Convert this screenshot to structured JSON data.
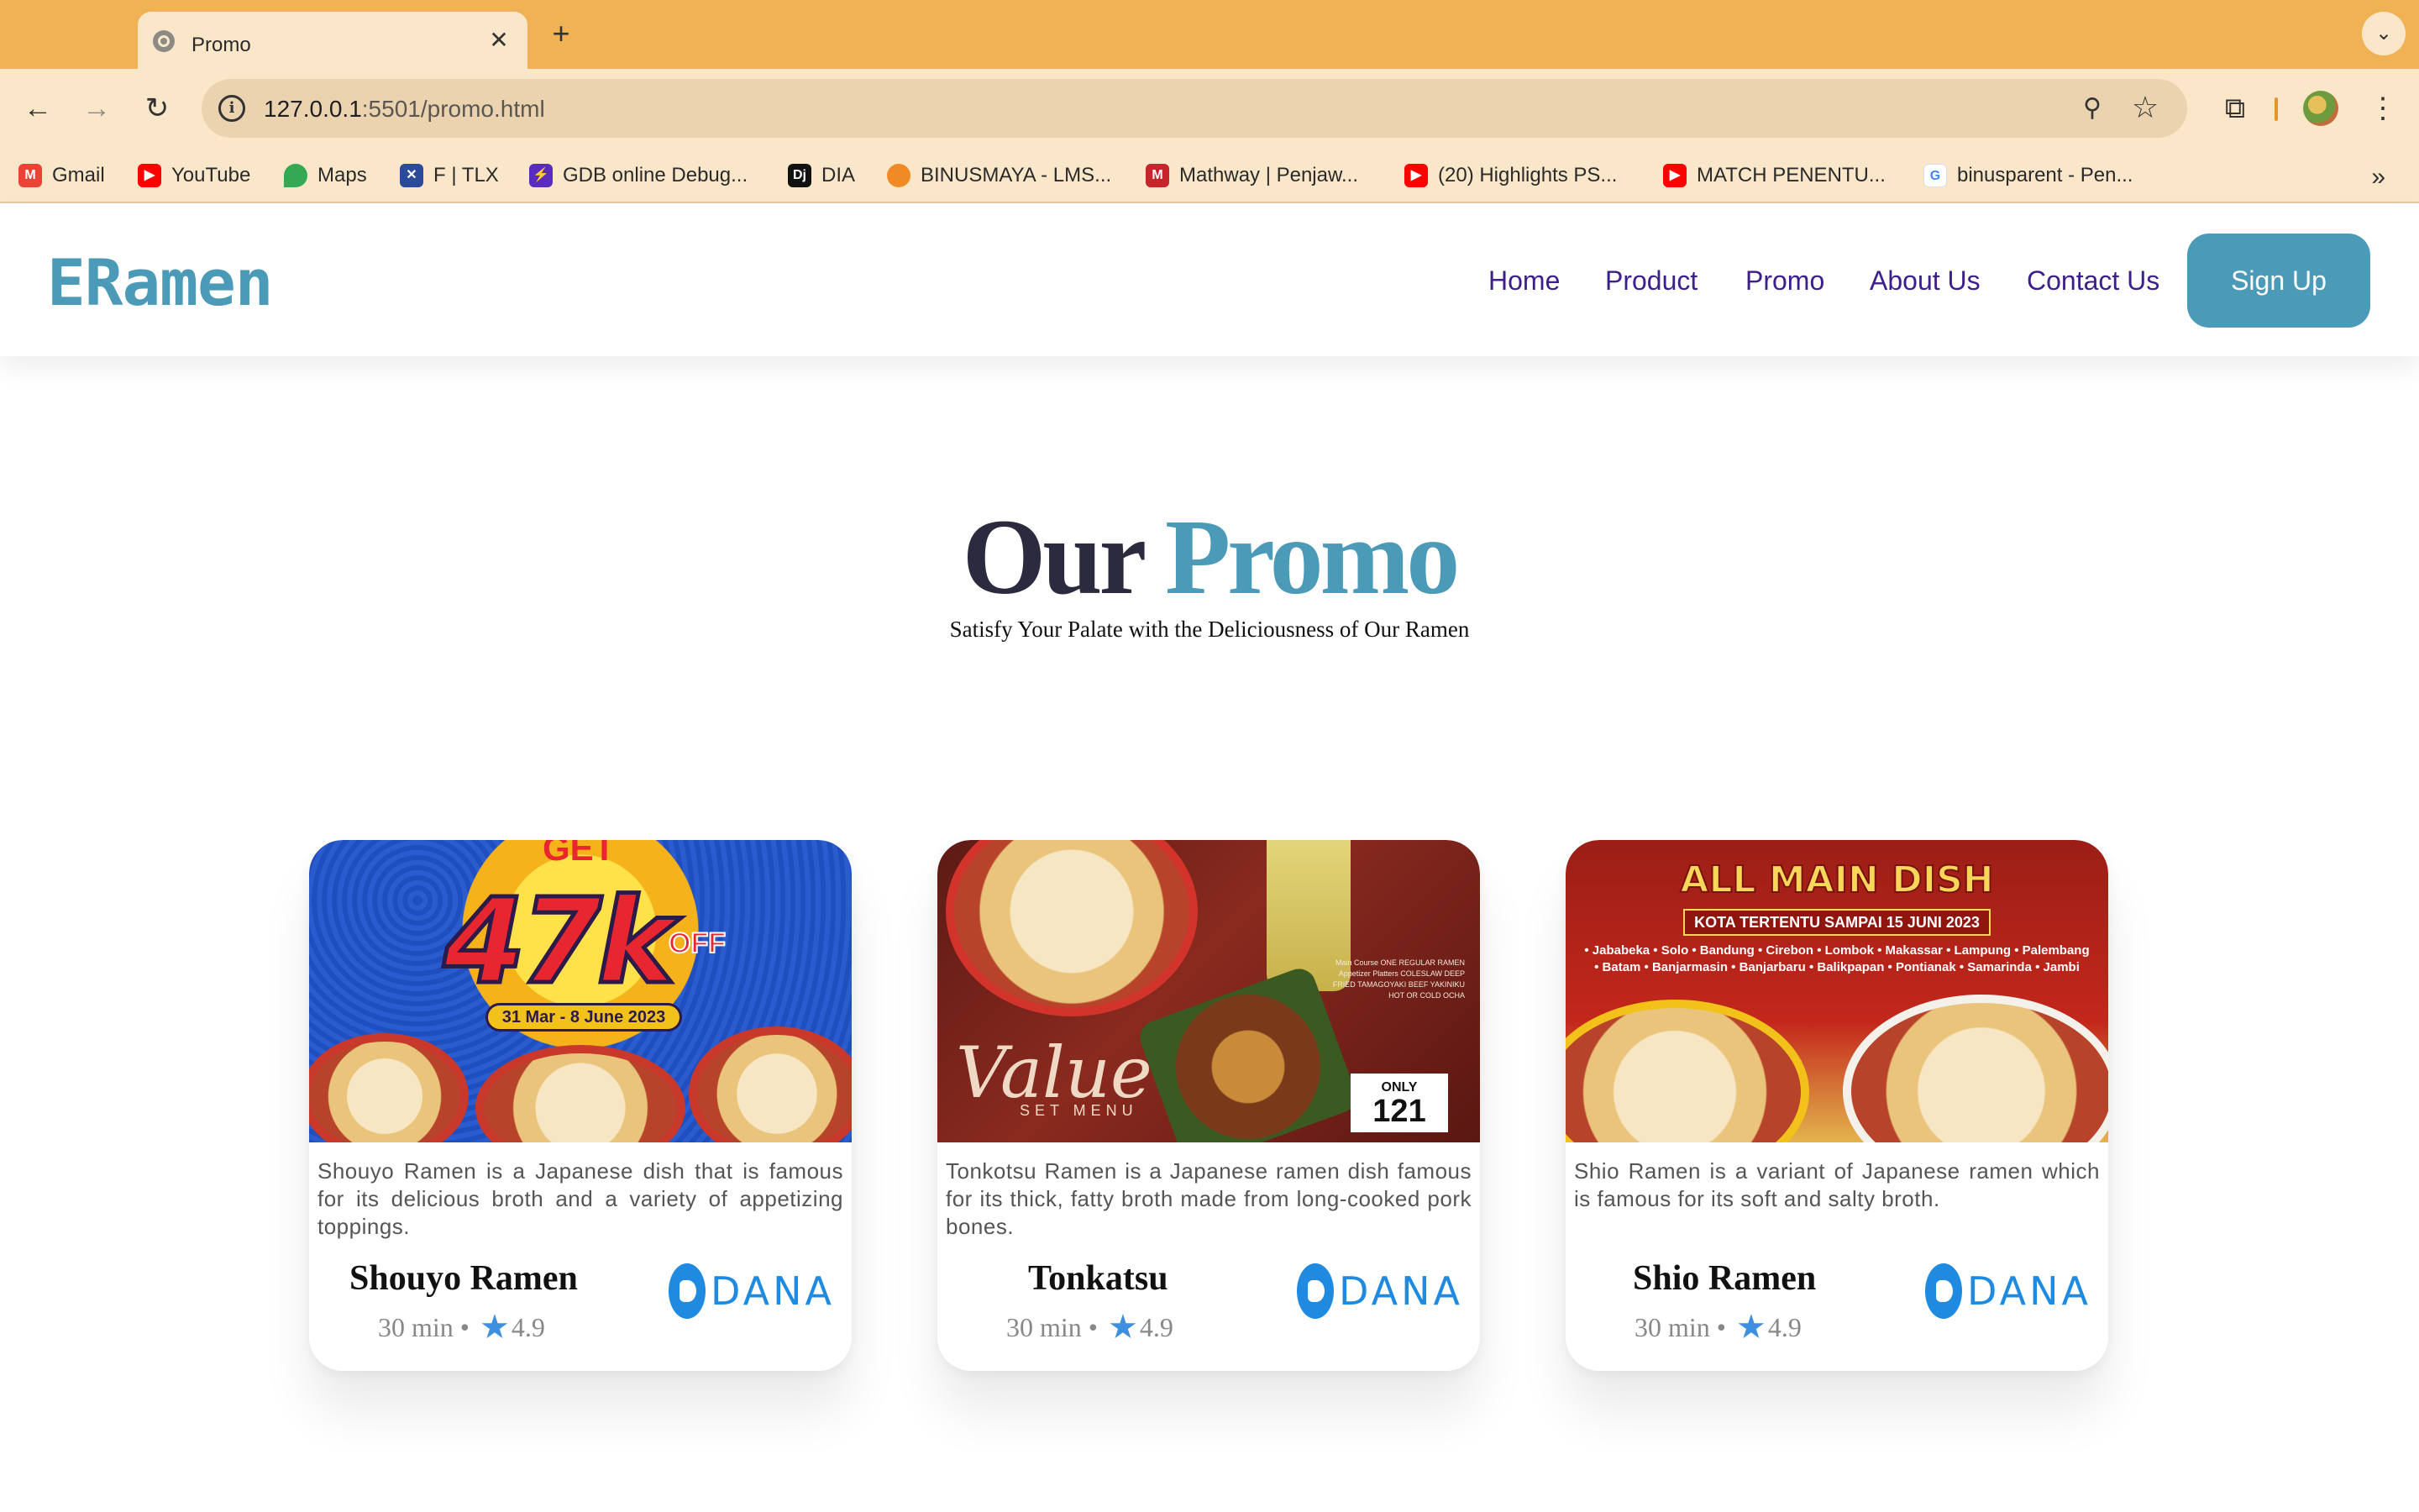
{
  "browser": {
    "tab_title": "Promo",
    "url_host": "127.0.0.1",
    "url_path": ":5501/promo.html",
    "bookmarks": [
      {
        "label": "Gmail",
        "icon": "gmail-icon",
        "color": "#ea4335"
      },
      {
        "label": "YouTube",
        "icon": "youtube-icon",
        "color": "#ff0000"
      },
      {
        "label": "Maps",
        "icon": "maps-icon",
        "color": "#34a853"
      },
      {
        "label": "F | TLX",
        "icon": "tlx-icon",
        "color": "#2a4a9a"
      },
      {
        "label": "GDB online Debug...",
        "icon": "gdb-icon",
        "color": "#5a2bbf"
      },
      {
        "label": "DIA",
        "icon": "dia-icon",
        "color": "#111111"
      },
      {
        "label": "BINUSMAYA - LMS...",
        "icon": "binusmaya-icon",
        "color": "#f08a24"
      },
      {
        "label": "Mathway | Penjaw...",
        "icon": "mathway-icon",
        "color": "#c8242c"
      },
      {
        "label": "(20) Highlights PS...",
        "icon": "youtube-icon",
        "color": "#ff0000"
      },
      {
        "label": "MATCH PENENTU...",
        "icon": "youtube-icon",
        "color": "#ff0000"
      },
      {
        "label": "binusparent - Pen...",
        "icon": "google-icon",
        "color": "#4285f4"
      }
    ]
  },
  "site": {
    "logo": "ERamen",
    "nav": [
      "Home",
      "Product",
      "Promo",
      "About Us",
      "Contact Us"
    ],
    "signup": "Sign Up",
    "accent_color": "#4a9ab8",
    "nav_color": "#3d1f8c"
  },
  "hero": {
    "title_part1": "Our",
    "title_part2": "Promo",
    "subtitle": "Satisfy Your Palate with the Deliciousness of Our Ramen"
  },
  "promos": [
    {
      "description": "Shouyo Ramen is a Japanese dish that is famous for its delicious broth and a variety of appetizing toppings.",
      "name": "Shouyo Ramen",
      "time": "30 min",
      "rating": "4.9",
      "payment": "DANA",
      "art": {
        "get": "GET",
        "amount": "47k",
        "off": "OFF",
        "date": "31 Mar - 8 June 2023"
      }
    },
    {
      "description": "Tonkotsu Ramen is a Japanese ramen dish famous for its thick, fatty broth made from long-cooked pork bones.",
      "name": "Tonkatsu",
      "time": "30 min",
      "rating": "4.9",
      "payment": "DANA",
      "art": {
        "value": "Value",
        "set_menu": "SET MENU",
        "only": "ONLY",
        "price": "121",
        "menu_lines": "Main Course ONE REGULAR RAMEN Appetizer Platters COLESLAW DEEP FRIED TAMAGOYAKI BEEF YAKINIKU HOT OR COLD OCHA"
      }
    },
    {
      "description": "Shio Ramen is a variant of Japanese ramen which is famous for its soft and salty broth.",
      "name": "Shio Ramen",
      "time": "30 min",
      "rating": "4.9",
      "payment": "DANA",
      "art": {
        "title": "ALL MAIN DISH",
        "ribbon": "KOTA TERTENTU SAMPAI 15 JUNI 2023",
        "cities": "• Jababeka • Solo • Bandung • Cirebon • Lombok • Makassar • Lampung • Palembang • Batam • Banjarmasin • Banjarbaru • Balikpapan • Pontianak • Samarinda • Jambi"
      }
    }
  ]
}
